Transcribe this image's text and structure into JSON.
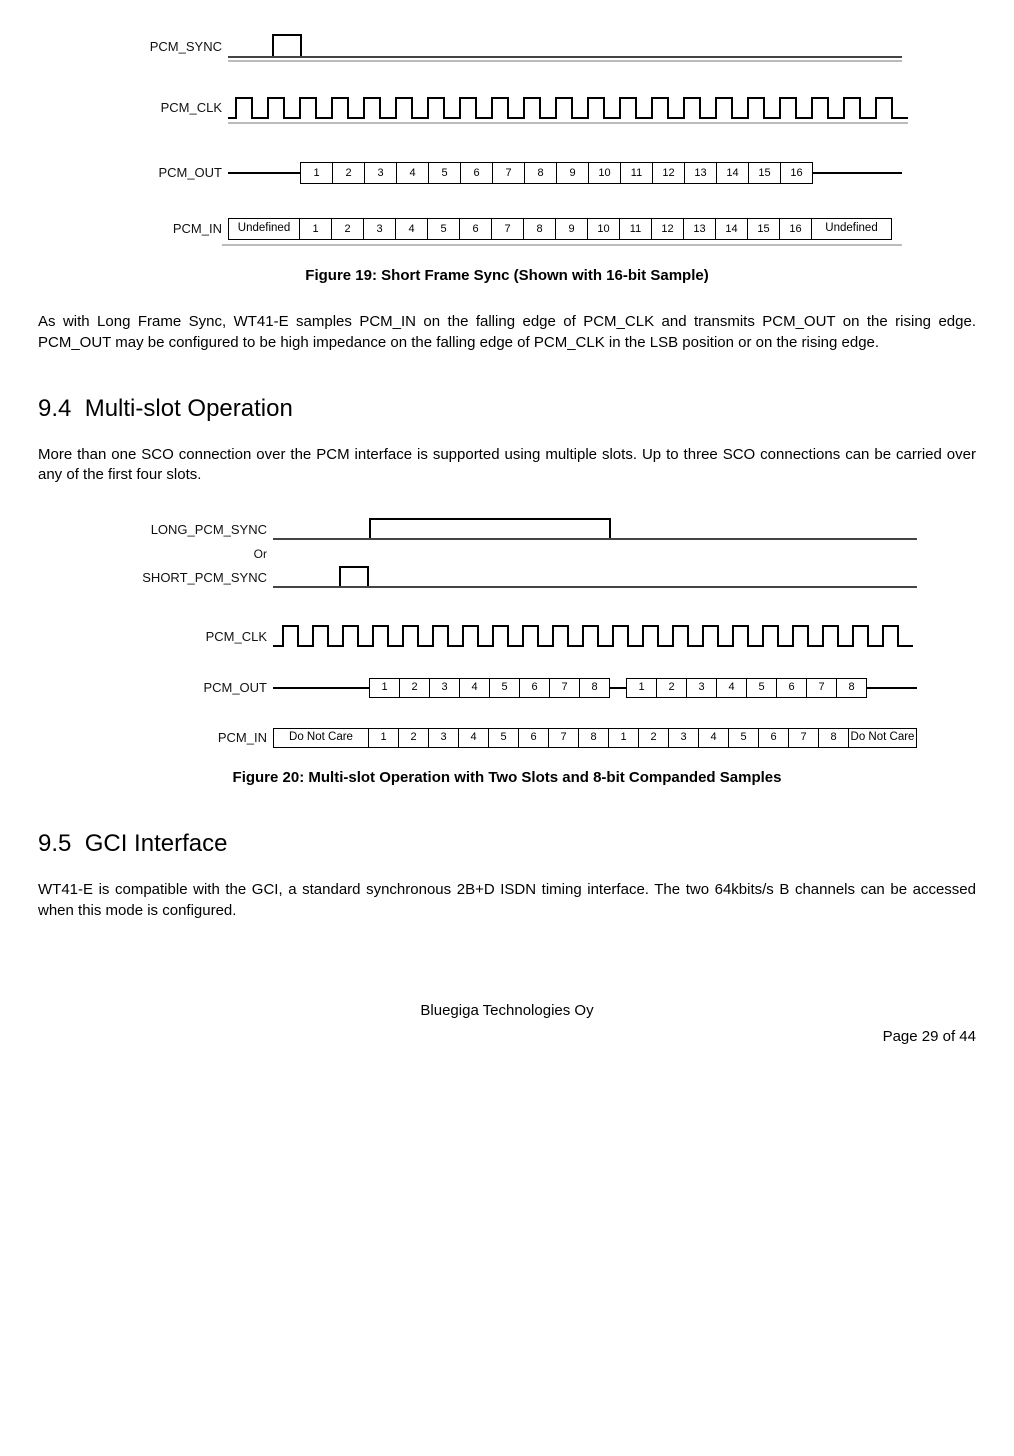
{
  "fig19": {
    "labels": {
      "sync": "PCM_SYNC",
      "clk": "PCM_CLK",
      "out": "PCM_OUT",
      "in": "PCM_IN"
    },
    "out_cells": [
      "1",
      "2",
      "3",
      "4",
      "5",
      "6",
      "7",
      "8",
      "9",
      "10",
      "11",
      "12",
      "13",
      "14",
      "15",
      "16"
    ],
    "in_left": "Undefined",
    "in_cells": [
      "1",
      "2",
      "3",
      "4",
      "5",
      "6",
      "7",
      "8",
      "9",
      "10",
      "11",
      "12",
      "13",
      "14",
      "15",
      "16"
    ],
    "in_right": "Undefined",
    "caption": "Figure 19: Short Frame Sync (Shown with 16-bit Sample)"
  },
  "para1": "As with Long Frame Sync, WT41-E samples PCM_IN on the falling edge of PCM_CLK and transmits PCM_OUT on the rising edge. PCM_OUT may be configured to be high impedance on the falling edge of PCM_CLK in the LSB position or on the rising edge.",
  "section94": {
    "number": "9.4",
    "title": "Multi-slot Operation",
    "para": "More than one SCO connection over the PCM interface is supported using multiple slots. Up to three SCO connections can be carried over any of the first four slots."
  },
  "fig20": {
    "labels": {
      "long": "LONG_PCM_SYNC",
      "or": "Or",
      "short": "SHORT_PCM_SYNC",
      "clk": "PCM_CLK",
      "out": "PCM_OUT",
      "in": "PCM_IN"
    },
    "out_cells_a": [
      "1",
      "2",
      "3",
      "4",
      "5",
      "6",
      "7",
      "8"
    ],
    "out_cells_b": [
      "1",
      "2",
      "3",
      "4",
      "5",
      "6",
      "7",
      "8"
    ],
    "in_left": "Do Not Care",
    "in_cells_a": [
      "1",
      "2",
      "3",
      "4",
      "5",
      "6",
      "7",
      "8"
    ],
    "in_cells_b": [
      "1",
      "2",
      "3",
      "4",
      "5",
      "6",
      "7",
      "8"
    ],
    "in_right": "Do Not Care",
    "caption": "Figure 20: Multi-slot Operation with Two Slots and 8-bit Companded Samples"
  },
  "section95": {
    "number": "9.5",
    "title": "GCI Interface",
    "para": "WT41-E is compatible with the GCI, a standard synchronous 2B+D ISDN timing interface. The two 64kbits/s B channels can be accessed when this mode is configured."
  },
  "footer": {
    "company": "Bluegiga Technologies Oy",
    "page": "Page 29 of 44"
  }
}
